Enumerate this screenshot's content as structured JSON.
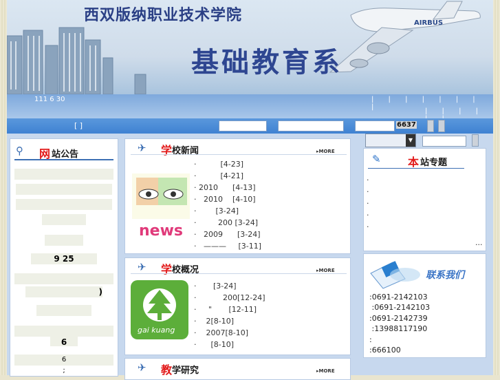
{
  "banner": {
    "school": "西双版纳职业技术学院",
    "dept": "基础教育系",
    "plane_text": "AIRBUS"
  },
  "infobar": {
    "date": "111 6 30",
    "sep_top": "| | | | | | | |",
    "sep_bottom": "| | | | | |"
  },
  "searchbar": {
    "bracket": "[ ]",
    "count": "6637"
  },
  "notice_panel": {
    "title_first": "网",
    "title_rest": "站公告",
    "lines": [
      "",
      "",
      "",
      "",
      "",
      "9 25",
      "",
      ")",
      "",
      "",
      "6",
      ";"
    ]
  },
  "news_panel": {
    "title_first": "学",
    "title_rest": "校新闻",
    "more": "▸MORE",
    "img_label": "news",
    "items": [
      "·          [4-23]",
      "·          [4-21]",
      "· 2010      [4-13]",
      "·   2010    [4-10]",
      "·        [3-24]",
      "·         200 [3-24]",
      "·   2009      [3-24]",
      "·   ———     [3-11]"
    ]
  },
  "overview_panel": {
    "title_first": "学",
    "title_rest": "校概况",
    "more": "▸MORE",
    "img_label": "gai kuang",
    "items": [
      "·       [3-24]",
      "·           200[12-24]",
      "·     \"       [12-11]",
      "·    2[8-10]",
      "·    2007[8-10]",
      "·      [8-10]"
    ]
  },
  "research_panel": {
    "title_first": "教",
    "title_rest": "学研究",
    "more": "▸MORE"
  },
  "topics_panel": {
    "title_first": "本",
    "title_rest": "站专题",
    "items": [
      ".",
      ".",
      ".",
      ".",
      "."
    ],
    "more": "..."
  },
  "contact_panel": {
    "title": "联系我们",
    "lines": [
      ":0691-2142103",
      " :0691-2142103",
      ":0691-2142739",
      " :13988117190",
      ":",
      ":666100"
    ]
  }
}
